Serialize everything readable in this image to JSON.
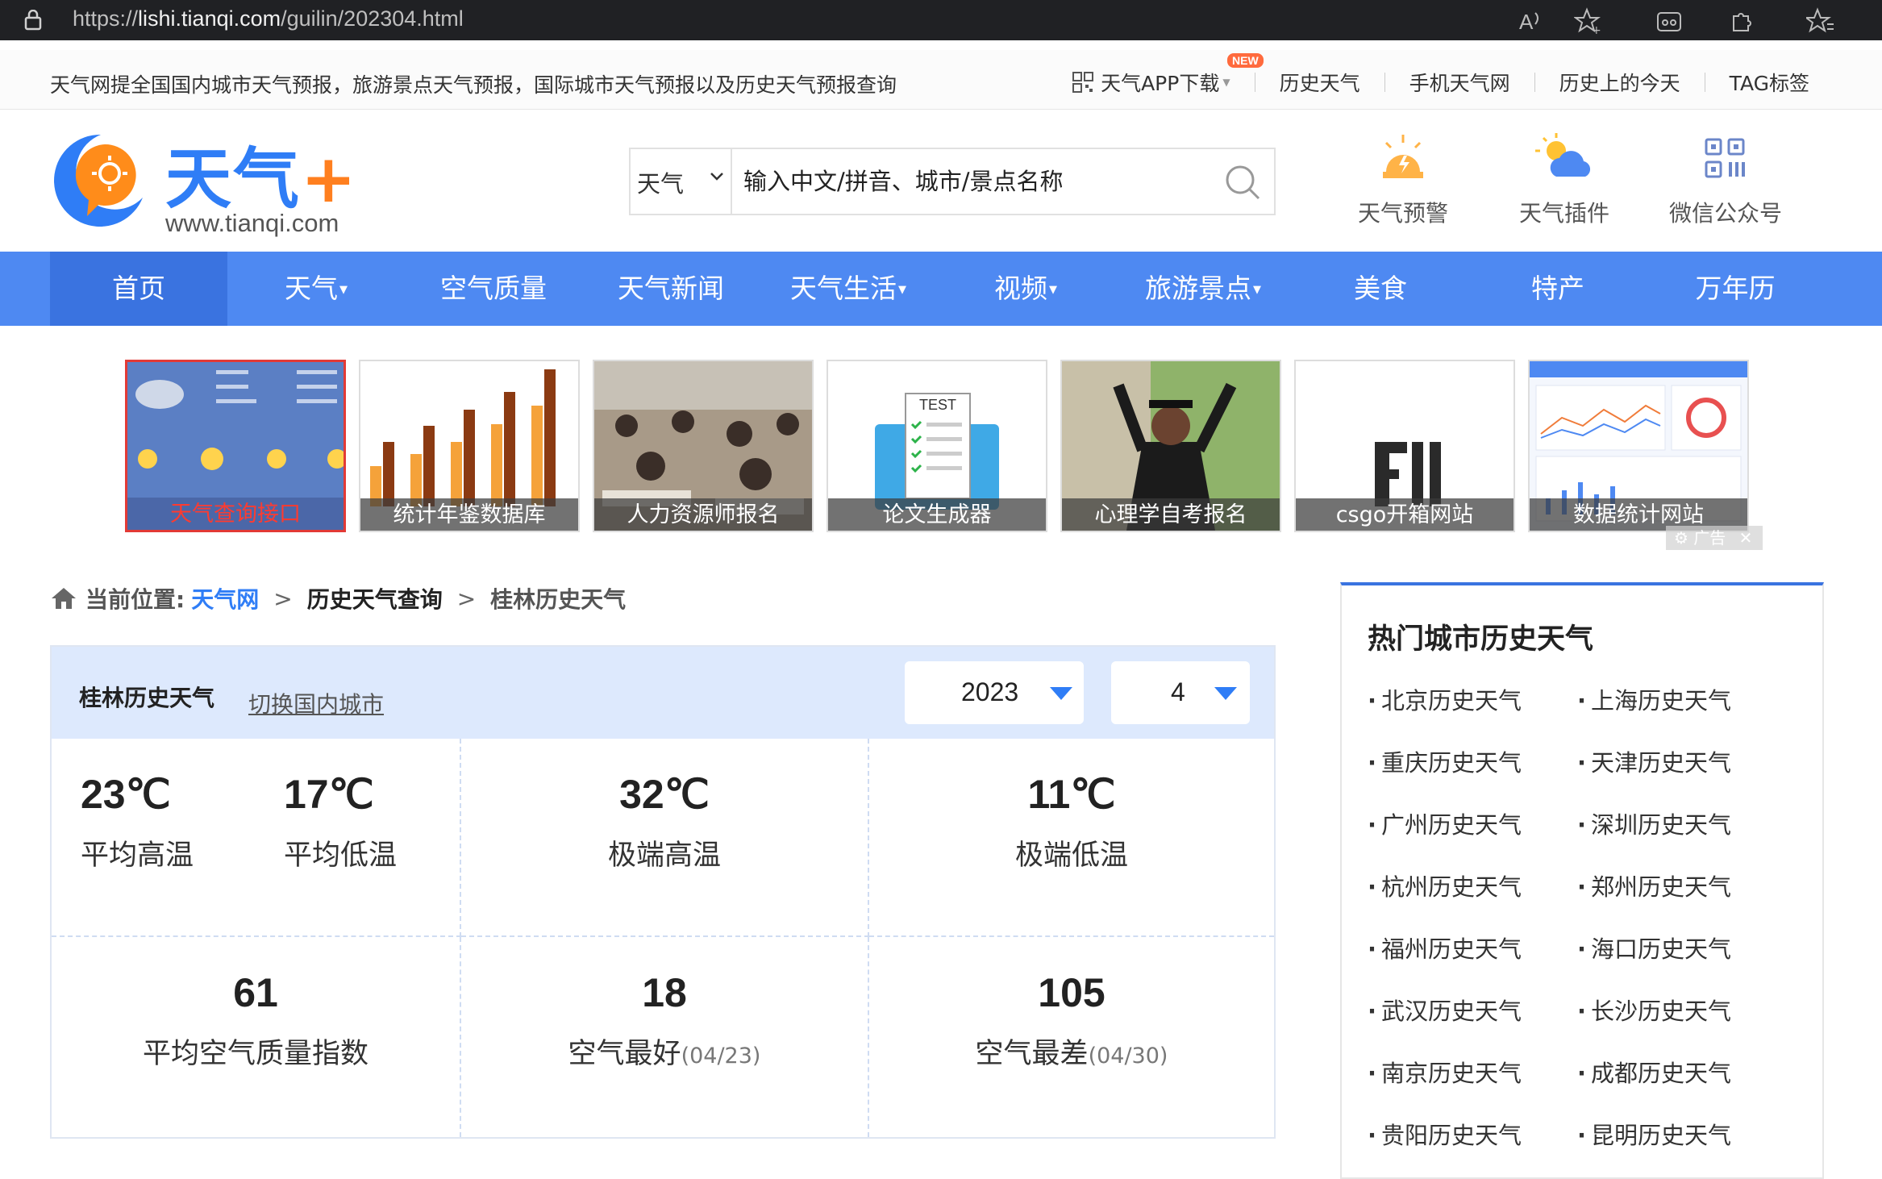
{
  "browser": {
    "url_prefix": "https://",
    "url_host": "lishi.tianqi.com",
    "url_path": "/guilin/202304.html"
  },
  "topline": {
    "intro": "天气网提全国国内城市天气预报，旅游景点天气预报，国际城市天气预报以及历史天气预报查询",
    "app_download": "天气APP下载",
    "new_badge": "NEW",
    "links": [
      "历史天气",
      "手机天气网",
      "历史上的今天",
      "TAG标签"
    ]
  },
  "logo": {
    "text": "天气",
    "plus": "+",
    "url": "www.tianqi.com"
  },
  "search": {
    "select_value": "天气",
    "placeholder": "输入中文/拼音、城市/景点名称"
  },
  "header_icons": [
    {
      "label": "天气预警",
      "icon": "warning-icon"
    },
    {
      "label": "天气插件",
      "icon": "sun-cloud-icon"
    },
    {
      "label": "微信公众号",
      "icon": "qrcode-icon"
    }
  ],
  "nav": {
    "items": [
      {
        "label": "首页",
        "caret": ""
      },
      {
        "label": "天气",
        "caret": "▼"
      },
      {
        "label": "空气质量",
        "caret": ""
      },
      {
        "label": "天气新闻",
        "caret": ""
      },
      {
        "label": "天气生活",
        "caret": "▼"
      },
      {
        "label": "视频",
        "caret": "▼"
      },
      {
        "label": "旅游景点",
        "caret": "▼"
      },
      {
        "label": "美食",
        "caret": ""
      },
      {
        "label": "特产",
        "caret": ""
      },
      {
        "label": "万年历",
        "caret": ""
      }
    ]
  },
  "banners": [
    {
      "caption": "天气查询接口"
    },
    {
      "caption": "统计年鉴数据库"
    },
    {
      "caption": "人力资源师报名"
    },
    {
      "caption": "论文生成器"
    },
    {
      "caption": "心理学自考报名"
    },
    {
      "caption": "csgo开箱网站"
    },
    {
      "caption": "数据统计网站"
    }
  ],
  "banner_test_text": "TEST",
  "ad_label": "广告",
  "breadcrumb": {
    "prefix": "当前位置:",
    "home": "天气网",
    "section": "历史天气查询",
    "current": "桂林历史天气",
    "separator": ">"
  },
  "panel": {
    "title": "桂林历史天气",
    "switch_link": "切换国内城市",
    "year": "2023",
    "month": "4",
    "stats": {
      "avg_high": {
        "value": "23℃",
        "label": "平均高温"
      },
      "avg_low": {
        "value": "17℃",
        "label": "平均低温"
      },
      "max_high": {
        "value": "32℃",
        "label": "极端高温"
      },
      "min_low": {
        "value": "11℃",
        "label": "极端低温"
      },
      "avg_aqi": {
        "value": "61",
        "label": "平均空气质量指数"
      },
      "best_air": {
        "value": "18",
        "label": "空气最好",
        "date": "(04/23)"
      },
      "worst_air": {
        "value": "105",
        "label": "空气最差",
        "date": "(04/30)"
      }
    }
  },
  "sidebar": {
    "title": "热门城市历史天气",
    "cities": [
      "北京历史天气",
      "上海历史天气",
      "重庆历史天气",
      "天津历史天气",
      "广州历史天气",
      "深圳历史天气",
      "杭州历史天气",
      "郑州历史天气",
      "福州历史天气",
      "海口历史天气",
      "武汉历史天气",
      "长沙历史天气",
      "南京历史天气",
      "成都历史天气",
      "贵阳历史天气",
      "昆明历史天气"
    ]
  },
  "colors": {
    "nav_blue": "#4e89f2",
    "nav_active": "#3a73e0",
    "link_blue": "#2f7df6",
    "logo_orange": "#ff7f1f",
    "panel_head": "#dde9fd"
  }
}
